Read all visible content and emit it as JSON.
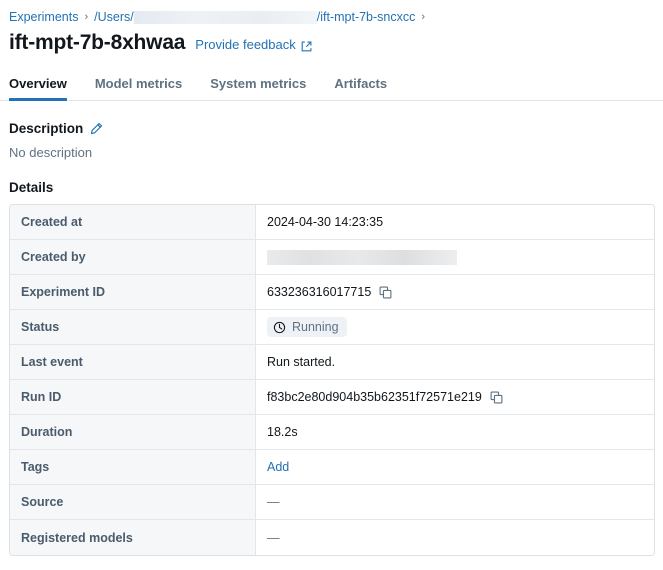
{
  "breadcrumb": {
    "root_label": "Experiments",
    "separator": "›",
    "path_prefix": "/Users/",
    "path_redacted": true,
    "path_suffix": "/ift-mpt-7b-sncxcc",
    "trailing_separator": "›"
  },
  "header": {
    "title": "ift-mpt-7b-8xhwaa",
    "feedback_label": "Provide feedback",
    "feedback_icon": "external-link-icon"
  },
  "tabs": [
    {
      "label": "Overview",
      "active": true
    },
    {
      "label": "Model metrics",
      "active": false
    },
    {
      "label": "System metrics",
      "active": false
    },
    {
      "label": "Artifacts",
      "active": false
    }
  ],
  "description": {
    "heading": "Description",
    "edit_icon": "pencil-icon",
    "body": "No description"
  },
  "details": {
    "heading": "Details",
    "rows": [
      {
        "label": "Created at",
        "value": "2024-04-30 14:23:35",
        "type": "text"
      },
      {
        "label": "Created by",
        "value": "",
        "type": "redacted"
      },
      {
        "label": "Experiment ID",
        "value": "633236316017715",
        "type": "copyable",
        "copy_icon": "copy-icon"
      },
      {
        "label": "Status",
        "value": "Running",
        "type": "badge",
        "badge_icon": "clock-icon"
      },
      {
        "label": "Last event",
        "value": "Run started.",
        "type": "text"
      },
      {
        "label": "Run ID",
        "value": "f83bc2e80d904b35b62351f72571e219",
        "type": "copyable",
        "copy_icon": "copy-icon"
      },
      {
        "label": "Duration",
        "value": "18.2s",
        "type": "text"
      },
      {
        "label": "Tags",
        "value": "Add",
        "type": "link"
      },
      {
        "label": "Source",
        "value": "—",
        "type": "dash"
      },
      {
        "label": "Registered models",
        "value": "—",
        "type": "dash"
      }
    ]
  },
  "colors": {
    "link": "#2272B4",
    "accent_underline": "#2272B4",
    "label_text": "#4A5B6B",
    "muted_text": "#5F7281",
    "badge_bg": "#EEF2F7",
    "table_border": "#DCE0E3",
    "label_cell_bg": "#F6F7F9"
  }
}
